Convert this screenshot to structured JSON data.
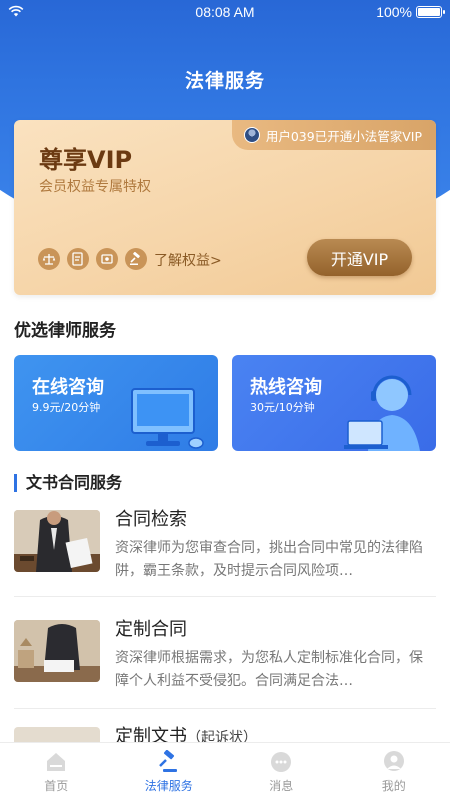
{
  "status_bar": {
    "time": "08:08 AM",
    "battery": "100%"
  },
  "header": {
    "title": "法律服务"
  },
  "vip": {
    "notice": "用户039已开通小法管家VIP",
    "title": "尊享VIP",
    "subtitle": "会员权益专属特权",
    "benefits_link": "了解权益>",
    "button": "开通VIP"
  },
  "lawyer_services": {
    "title": "优选律师服务",
    "cards": [
      {
        "title": "在线咨询",
        "price": "9.9元/20分钟"
      },
      {
        "title": "热线咨询",
        "price": "30元/10分钟"
      }
    ]
  },
  "doc_services": {
    "title": "文书合同服务",
    "items": [
      {
        "name": "合同检索",
        "desc": "资深律师为您审查合同，挑出合同中常见的法律陷阱，霸王条款，及时提示合同风险项…"
      },
      {
        "name": "定制合同",
        "desc": "资深律师根据需求，为您私人定制标准化合同，保障个人利益不受侵犯。合同满足合法…"
      },
      {
        "name": "定制文书",
        "tag": "（起诉状）"
      }
    ]
  },
  "tabs": [
    {
      "label": "首页",
      "icon": "home-icon"
    },
    {
      "label": "法律服务",
      "icon": "gavel-icon",
      "active": true
    },
    {
      "label": "消息",
      "icon": "message-icon"
    },
    {
      "label": "我的",
      "icon": "profile-icon"
    }
  ],
  "colors": {
    "primary": "#2f73e3",
    "vip_gold": "#94622b",
    "vip_bg": "#f6d5a9"
  }
}
